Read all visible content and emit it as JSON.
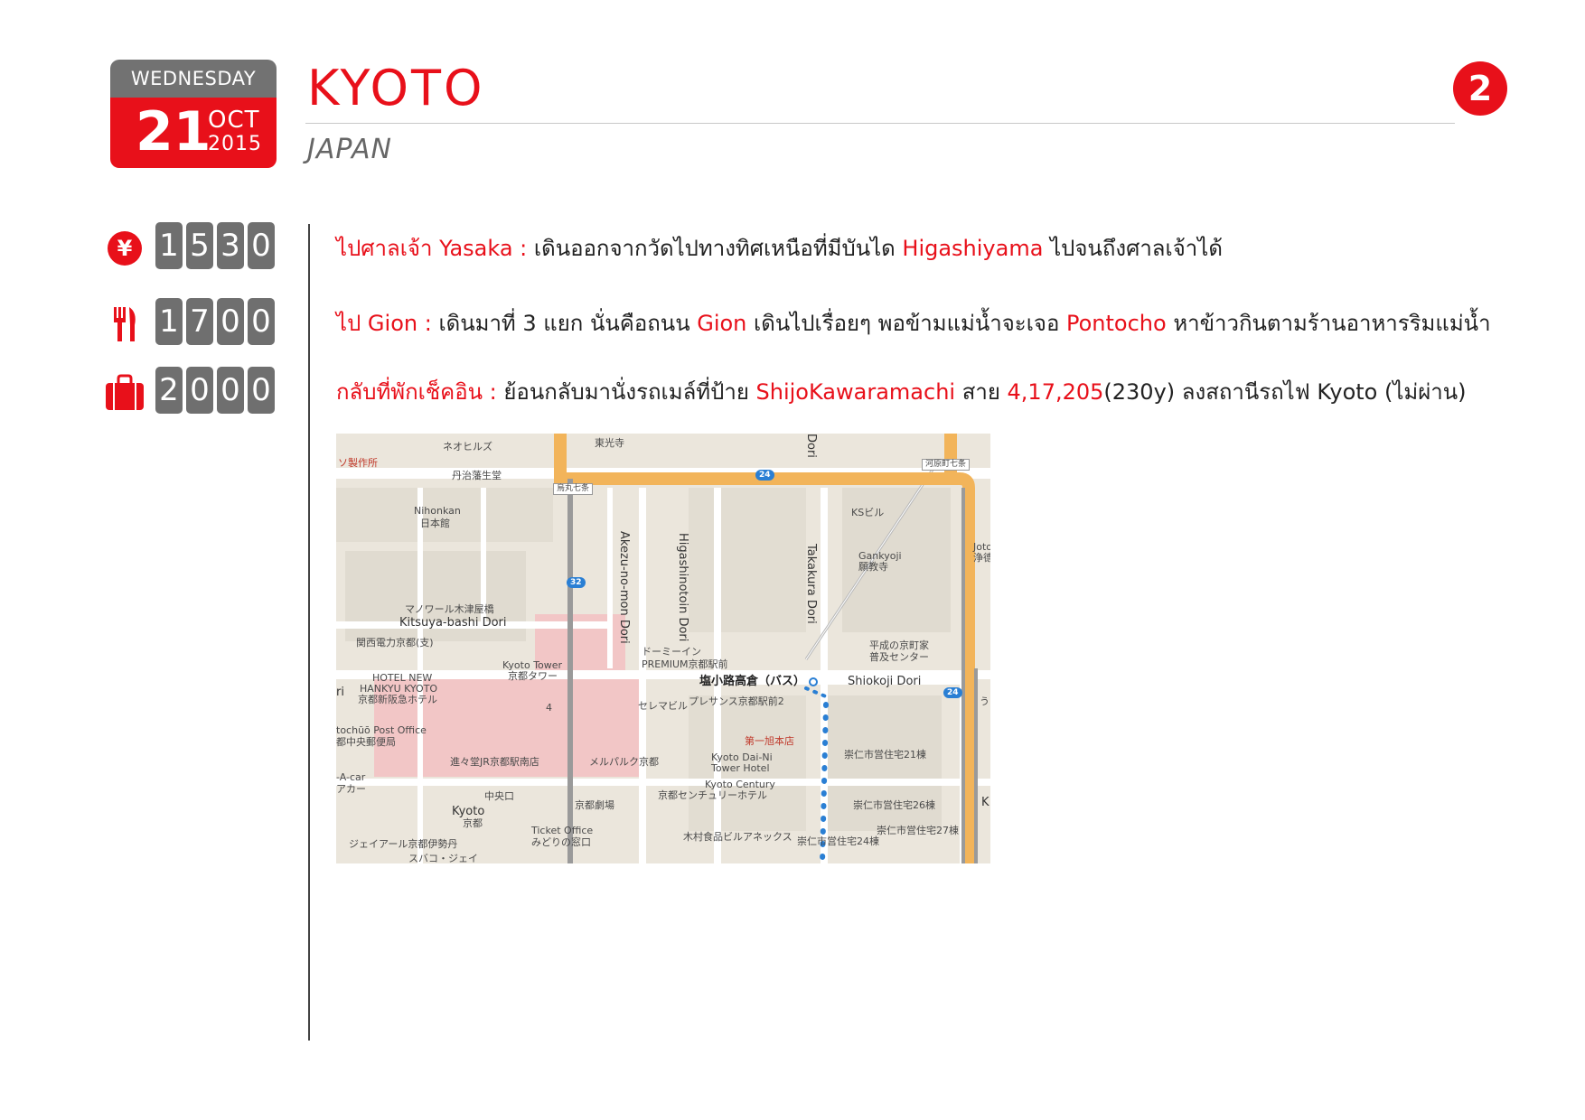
{
  "date": {
    "weekday": "WEDNESDAY",
    "day": "21",
    "month": "OCT",
    "year": "2015"
  },
  "header": {
    "city": "KYOTO",
    "country": "JAPAN",
    "page_number": "2"
  },
  "costs": [
    {
      "icon": "yen-icon",
      "digits": [
        "1",
        "5",
        "3",
        "0"
      ]
    },
    {
      "icon": "fork-knife-icon",
      "digits": [
        "1",
        "7",
        "0",
        "0"
      ]
    },
    {
      "icon": "suitcase-icon",
      "digits": [
        "2",
        "0",
        "0",
        "0"
      ]
    }
  ],
  "itinerary": [
    {
      "parts": [
        {
          "text": "ไปศาลเจ้า Yasaka : ",
          "red": true
        },
        {
          "text": "เดินออกจากวัดไปทางทิศเหนือที่มีบันได ",
          "red": false
        },
        {
          "text": "Higashiyama",
          "red": true
        },
        {
          "text": " ไปจนถึงศาลเจ้าได้",
          "red": false
        }
      ]
    },
    {
      "parts": [
        {
          "text": "ไป Gion : ",
          "red": true
        },
        {
          "text": "เดินมาที่ 3 แยก นั่นคือถนน ",
          "red": false
        },
        {
          "text": "Gion",
          "red": true
        },
        {
          "text": " เดินไปเรื่อยๆ พอข้ามแม่น้ำจะเจอ ",
          "red": false
        },
        {
          "text": "Pontocho",
          "red": true
        },
        {
          "text": " หาข้าวกินตามร้านอาหารริมแม่น้ำ",
          "red": false
        }
      ]
    },
    {
      "parts": [
        {
          "text": "กลับที่พักเช็คอิน : ",
          "red": true
        },
        {
          "text": "ย้อนกลับมานั่งรถเมล์ที่ป้าย ",
          "red": false
        },
        {
          "text": "ShijoKawaramachi",
          "red": true
        },
        {
          "text": " สาย ",
          "red": false
        },
        {
          "text": "4,17,205",
          "red": true
        },
        {
          "text": "(230y) ลงสถานีรถไฟ Kyoto (ไม่ผ่าน)",
          "red": false
        }
      ]
    }
  ],
  "map": {
    "labels": {
      "neohiruzu": "ネオヒルズ",
      "tofukuji": "東光寺",
      "seisakusho": "ソ製作所",
      "tanjiseisei": "丹治藩生堂",
      "karasuma7": "烏丸七条",
      "kawaramachi7": "河原町七条",
      "route24_top": "24",
      "route24_right": "24",
      "route32": "32",
      "ks_building": "KSビル",
      "nihonkan_en": "Nihonkan",
      "nihonkan_jp": "日本館",
      "gankyoji_en": "Gankyoji",
      "gankyoji_jp": "願教寺",
      "joto_en": "Joto",
      "joto_jp": "浄德",
      "manoir": "マノワール木津屋橋",
      "kitsuya": "Kitsuya-bashi Dori",
      "kepco": "関西電力京都(支)",
      "kyoto_tower_en": "Kyoto Tower",
      "kyoto_tower_jp": "京都タワー",
      "hotel_new": "HOTEL NEW",
      "hankyu_kyoto": "HANKYU KYOTO",
      "hankyu_jp": "京都新阪急ホテル",
      "dormy_inn": "ドーミーイン",
      "premium": "PREMIUM京都駅前",
      "heisei": "平成の京町家",
      "fukyu": "普及センター",
      "shiokoji_bus": "塩小路高倉（バス）",
      "shiokoji_dori": "Shiokoji Dori",
      "selemale": "セレマビル",
      "plesance": "プレサンス京都駅前2",
      "ri": "ri",
      "u": "う",
      "post_en": "tochūō Post Office",
      "post_jp": "都中央郵便局",
      "dai1asahi": "第一旭本店",
      "sujin21": "崇仁市営住宅21棟",
      "sujin26": "崇仁市営住宅26棟",
      "sujin27": "崇仁市営住宅27棟",
      "sujin24": "崇仁市営住宅24棟",
      "shinshin": "進々堂JR京都駅南店",
      "meruparuku": "メルパルク京都",
      "dai_ni_en": "Kyoto Dai-Ni",
      "dai_ni_tower": "Tower Hotel",
      "century_en": "Kyoto Century",
      "century_jp": "京都センチュリーホテル",
      "aacar": "-A-car",
      "aacar_jp": "アカー",
      "chuoguchi": "中央口",
      "kyoto_st_en": "Kyoto",
      "kyoto_st_jp": "京都",
      "kyoto_gekijo": "京都劇場",
      "kimura": "木村食品ビルアネックス",
      "ticket_en": "Ticket Office",
      "ticket_jp": "みどりの窓口",
      "isetan": "ジェイアール京都伊勢丹",
      "supaco": "スバコ・ジェイ",
      "k": "K",
      "four": "4",
      "higashinotoin": "Higashinotoin Dori",
      "akezu": "Akezu-no-mon Dori",
      "takakura": "Takakura Dori",
      "dori": "Dori"
    }
  }
}
